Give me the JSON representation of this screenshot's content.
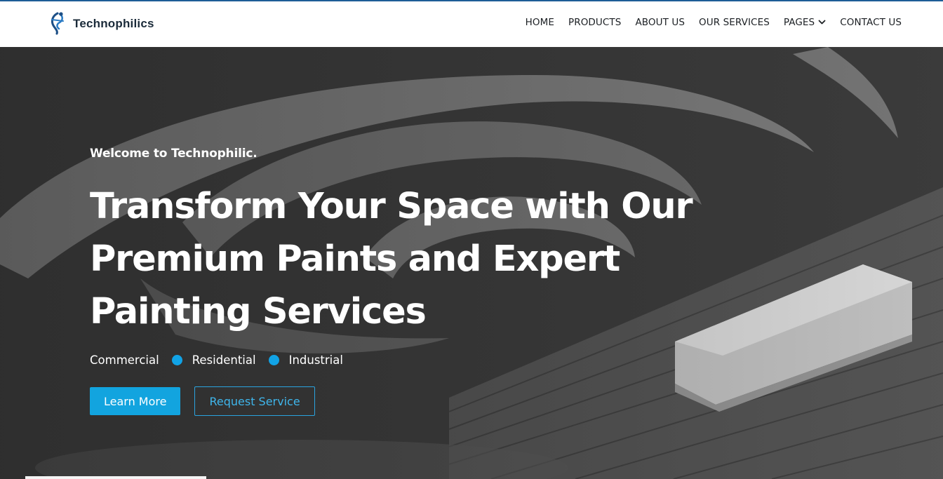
{
  "brand": {
    "name": "Technophilics",
    "logo_icon": "figure-logo-icon",
    "accent": "#1d5d96"
  },
  "nav": {
    "items": [
      {
        "label": "HOME"
      },
      {
        "label": "PRODUCTS"
      },
      {
        "label": "ABOUT US"
      },
      {
        "label": "OUR SERVICES"
      },
      {
        "label": "PAGES",
        "icon": "chevron-down-icon"
      },
      {
        "label": "CONTACT US"
      }
    ]
  },
  "hero": {
    "kicker": "Welcome to Technophilic.",
    "headline": "Transform Your Space with Our Premium Paints and Expert Painting Services",
    "tags": [
      "Commercial",
      "Residential",
      "Industrial"
    ],
    "tag_dot_color": "#11a3e6",
    "primary_button": "Learn More",
    "secondary_button": "Request Service",
    "button_color": "#12a4df"
  }
}
